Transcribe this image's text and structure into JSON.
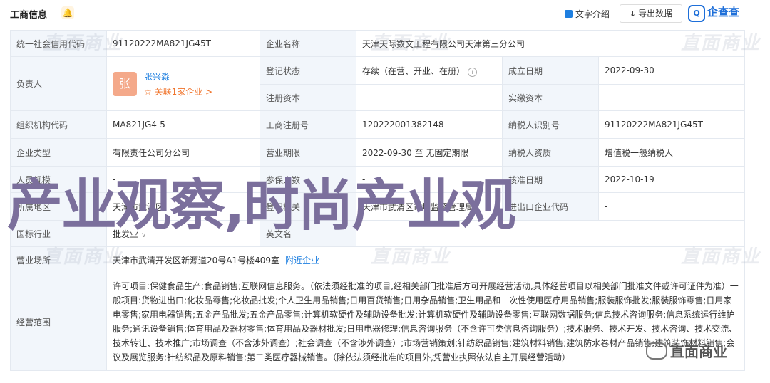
{
  "header": {
    "title": "工商信息",
    "intro_label": "文字介绍",
    "export_label": "导出数据",
    "logo_text": "企查查"
  },
  "rows": {
    "credit_code_label": "统一社会信用代码",
    "credit_code_value": "91120222MA821JG45T",
    "company_name_label": "企业名称",
    "company_name_value": "天津天际数文工程有限公司天津第三分公司",
    "legal_person_label": "负责人",
    "legal_person_avatar": "张",
    "legal_person_name": "张兴淼",
    "legal_person_relation": "关联1家企业 >",
    "reg_status_label": "登记状态",
    "reg_status_value": "存续（在营、开业、在册）",
    "found_date_label": "成立日期",
    "found_date_value": "2022-09-30",
    "reg_capital_label": "注册资本",
    "reg_capital_value": "-",
    "paid_capital_label": "实缴资本",
    "paid_capital_value": "-",
    "org_code_label": "组织机构代码",
    "org_code_value": "MA821JG4-5",
    "reg_no_label": "工商注册号",
    "reg_no_value": "120222001382148",
    "tax_id_label": "纳税人识别号",
    "tax_id_value": "91120222MA821JG45T",
    "type_label": "企业类型",
    "type_value": "有限责任公司分公司",
    "term_label": "营业期限",
    "term_value": "2022-09-30 至 无固定期限",
    "tax_qual_label": "纳税人资质",
    "tax_qual_value": "增值税一般纳税人",
    "size_label": "人员规模",
    "size_value": "-",
    "insured_label": "参保人数",
    "insured_value": "-",
    "approve_label": "核准日期",
    "approve_value": "2022-10-19",
    "region_label": "所属地区",
    "region_value": "天津市武清区",
    "authority_label": "登记机关",
    "authority_value": "天津市武清区市场监督管理局",
    "import_label": "进出口企业代码",
    "import_value": "-",
    "industry_label": "国标行业",
    "industry_value": "批发业",
    "english_label": "英文名",
    "english_value": "-",
    "address_label": "营业场所",
    "address_value": "天津市武清开发区新源道20号A1号楼409室",
    "nearby_label": "附近企业",
    "scope_label": "经营范围",
    "scope_value": "许可项目:保健食品生产;食品销售;互联网信息服务。（依法须经批准的项目,经相关部门批准后方可开展经营活动,具体经营项目以相关部门批准文件或许可证件为准）一般项目:货物进出口;化妆品零售;化妆品批发;个人卫生用品销售;日用百货销售;日用杂品销售;卫生用品和一次性使用医疗用品销售;服装服饰批发;服装服饰零售;日用家电零售;家用电器销售;五金产品批发;五金产品零售;计算机软硬件及辅助设备批发;计算机软硬件及辅助设备零售;互联网数据服务;信息技术咨询服务;信息系统运行维护服务;通讯设备销售;体育用品及器材零售;体育用品及器材批发;日用电器修理;信息咨询服务（不含许可类信息咨询服务）;技术服务、技术开发、技术咨询、技术交流、技术转让、技术推广;市场调查（不含涉外调查）;社会调查（不含涉外调查）;市场营销策划;针纺织品销售;建筑材料销售;建筑防水卷材产品销售;建筑装饰材料销售;会议及展览服务;针纺织品及原料销售;第二类医疗器械销售。（除依法须经批准的项目外,凭营业执照依法自主开展经营活动）"
  },
  "overlay": {
    "banner_text": "产业观察,时尚产业观",
    "watermark_text": "直面商业",
    "wechat_text": "直面商业"
  },
  "colors": {
    "label_bg": "#f2f6fb",
    "link": "#1e7fe0",
    "banner": "#7b6f9c"
  }
}
